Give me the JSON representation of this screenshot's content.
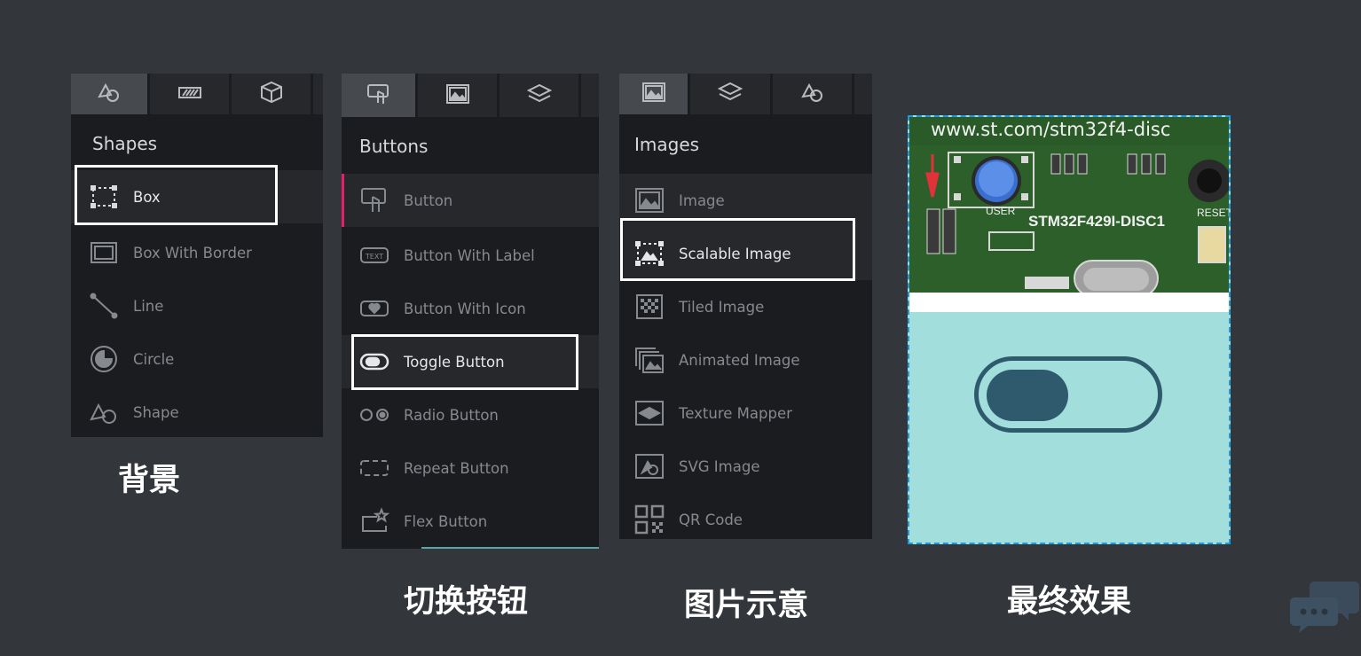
{
  "panels": {
    "shapes": {
      "title": "Shapes",
      "tabs": [
        "shapes-icon",
        "gradient-icon",
        "cube-icon"
      ],
      "items": [
        {
          "label": "Box",
          "icon": "box-icon"
        },
        {
          "label": "Box With Border",
          "icon": "box-border-icon"
        },
        {
          "label": "Line",
          "icon": "line-icon"
        },
        {
          "label": "Circle",
          "icon": "circle-icon"
        },
        {
          "label": "Shape",
          "icon": "shape-icon"
        }
      ],
      "highlighted": "Box",
      "caption": "背景"
    },
    "buttons": {
      "title": "Buttons",
      "tabs": [
        "button-touch-icon",
        "image-icon",
        "layers-icon"
      ],
      "items": [
        {
          "label": "Button",
          "icon": "button-touch-icon"
        },
        {
          "label": "Button With Label",
          "icon": "text-button-icon"
        },
        {
          "label": "Button With Icon",
          "icon": "heart-button-icon"
        },
        {
          "label": "Toggle Button",
          "icon": "toggle-icon"
        },
        {
          "label": "Radio Button",
          "icon": "radio-icon"
        },
        {
          "label": "Repeat Button",
          "icon": "repeat-button-icon"
        },
        {
          "label": "Flex Button",
          "icon": "flex-button-icon"
        }
      ],
      "highlighted": "Toggle Button",
      "caption": "切换按钮"
    },
    "images": {
      "title": "Images",
      "tabs": [
        "image-icon",
        "layers-icon",
        "shapes-icon"
      ],
      "items": [
        {
          "label": "Image",
          "icon": "image-icon"
        },
        {
          "label": "Scalable Image",
          "icon": "scalable-image-icon"
        },
        {
          "label": "Tiled Image",
          "icon": "tiled-image-icon"
        },
        {
          "label": "Animated Image",
          "icon": "animated-image-icon"
        },
        {
          "label": "Texture Mapper",
          "icon": "texture-mapper-icon"
        },
        {
          "label": "SVG Image",
          "icon": "svg-image-icon"
        },
        {
          "label": "QR Code",
          "icon": "qr-code-icon"
        }
      ],
      "highlighted": "Scalable Image",
      "caption": "图片示意"
    }
  },
  "preview": {
    "url_text": "www.st.com/stm32f4-disc",
    "board_text": "STM32F429I-DISC1",
    "user_text": "USER",
    "reset_text": "RESET",
    "caption": "最终效果",
    "background_color": "#a2dedc",
    "toggle_color": "#2f5a6e",
    "toggle_state": "off"
  },
  "colors": {
    "page_bg": "#33363b",
    "panel_bg": "#1b1c1f",
    "tabbar_bg": "#26282c",
    "active_tab_bg": "#46494e",
    "accent_pink": "#e4206e",
    "selection_border": "#1c9ade"
  }
}
